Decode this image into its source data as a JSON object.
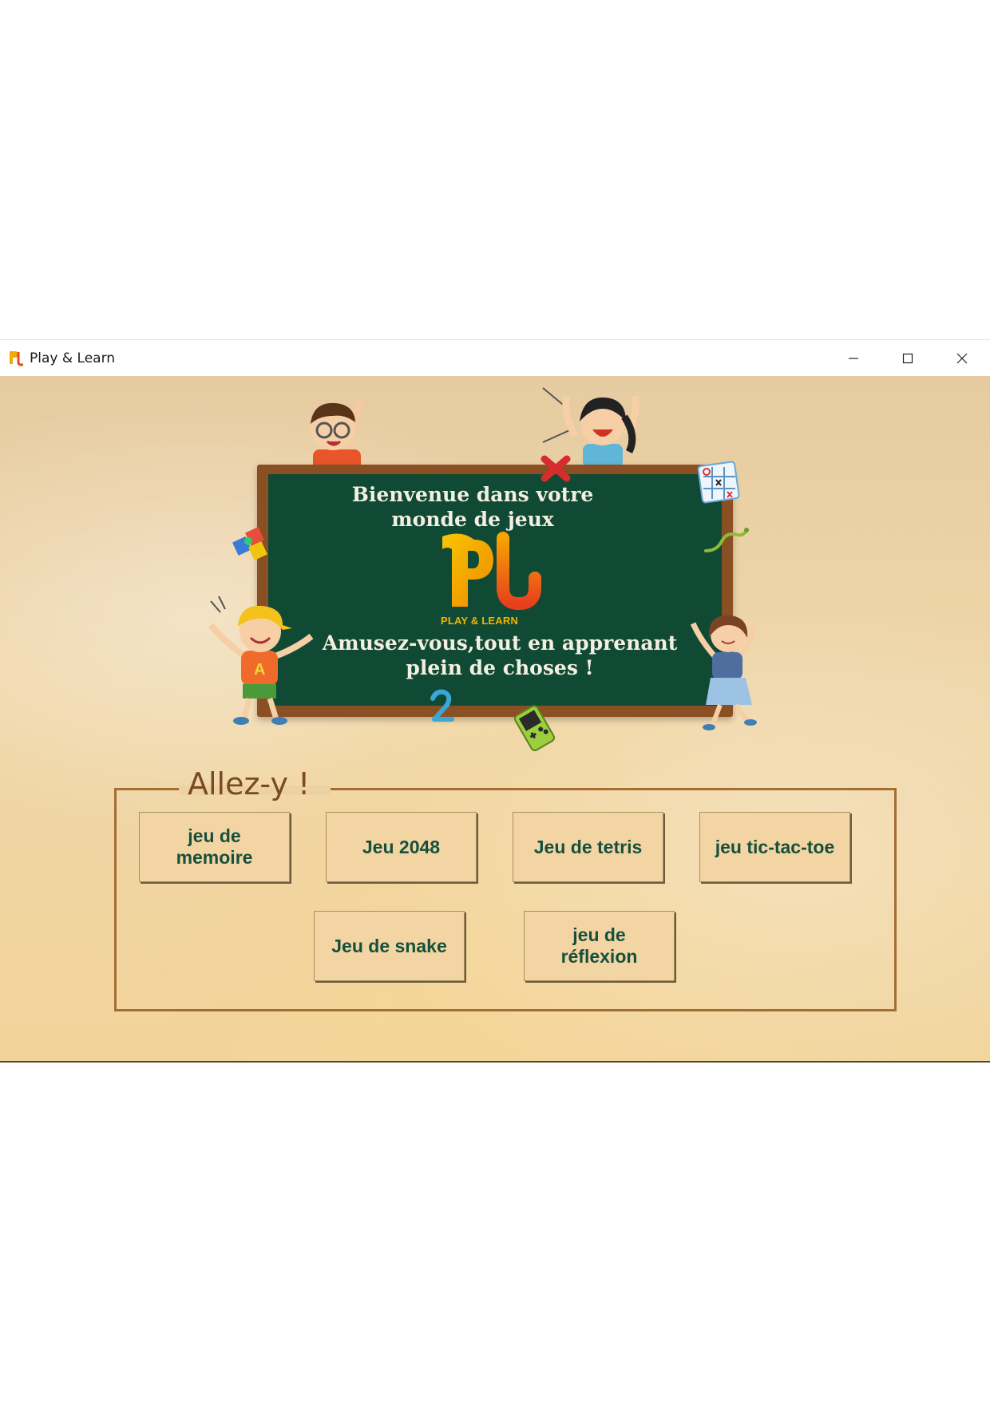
{
  "window": {
    "title": "Play & Learn",
    "icon": "pl-logo-icon",
    "controls": {
      "minimize": "minimize-icon",
      "maximize": "maximize-icon",
      "close": "close-icon"
    }
  },
  "board": {
    "title_line1": "Bienvenue dans votre",
    "title_line2": "monde de jeux",
    "logo_caption": "PLAY & LEARN",
    "subtitle_line1": "Amusez-vous,tout en apprenant",
    "subtitle_line2": "plein de choses !"
  },
  "games": {
    "legend": "Allez-y !",
    "memoire_line1": "jeu de",
    "memoire_line2": "memoire",
    "g2048": "Jeu 2048",
    "tetris": "Jeu de tetris",
    "tictactoe": "jeu tic-tac-toe",
    "snake": "Jeu de snake",
    "reflexion_line1": "jeu de",
    "reflexion_line2": "réflexion"
  },
  "colors": {
    "board": "#114a34",
    "frame": "#8a4f22",
    "button_bg": "#f3d5a4",
    "button_text": "#16503c",
    "legend": "#7b4a22"
  }
}
